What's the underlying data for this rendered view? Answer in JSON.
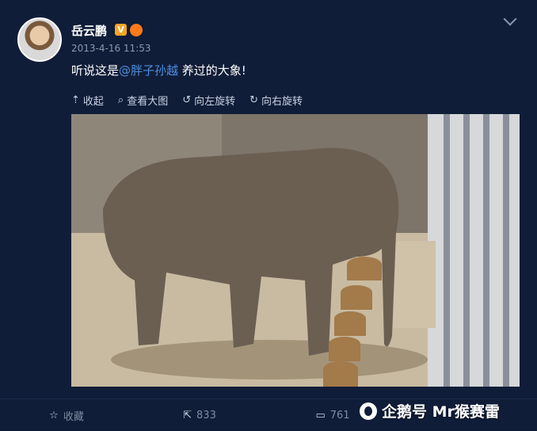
{
  "post": {
    "username": "岳云鹏",
    "badge_v": "V",
    "badge_vip": "VIP",
    "timestamp": "2013-4-16 11:53",
    "text_before": "听说这是",
    "mention": "@胖子孙越",
    "text_after": " 养过的大象!"
  },
  "media_toolbar": {
    "collapse": "收起",
    "view_large": "查看大图",
    "rotate_left": "向左旋转",
    "rotate_right": "向右旋转"
  },
  "footer": {
    "favorite": "收藏",
    "repost_count": "833",
    "comment_count": "761"
  },
  "watermark": {
    "text": "企鹅号 Mr猴赛雷"
  },
  "icons": {
    "collapse": "arrow-up-icon",
    "view_large": "magnifier-icon",
    "rotate_left": "rotate-left-icon",
    "rotate_right": "rotate-right-icon",
    "favorite": "star-icon",
    "repost": "share-icon",
    "comment": "comment-icon"
  },
  "colors": {
    "background": "#0f1d38",
    "mention": "#4f8fe0"
  }
}
